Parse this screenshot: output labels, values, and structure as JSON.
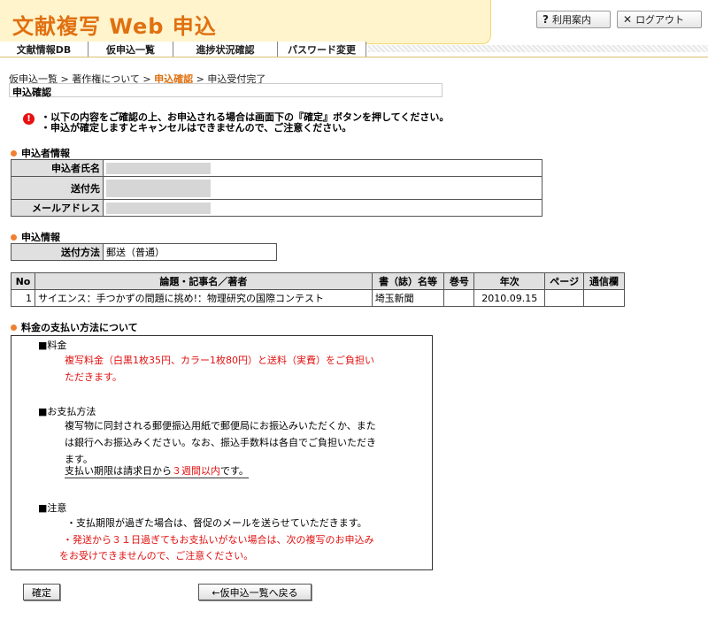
{
  "header": {
    "logo": "文献複写 Web 申込",
    "help_label": "利用案内",
    "help_icon": "?",
    "logout_label": "ログアウト",
    "logout_icon": "✕"
  },
  "nav": {
    "tabs": [
      {
        "label": "文献情報DB"
      },
      {
        "label": "仮申込一覧"
      },
      {
        "label": "進捗状況確認"
      },
      {
        "label": "パスワード変更"
      }
    ]
  },
  "breadcrumb": {
    "items": [
      "仮申込一覧",
      "著作権について",
      "申込確認",
      "申込受付完了"
    ],
    "separator": " > "
  },
  "page_title": "申込確認",
  "notice": {
    "icon": "!",
    "lines": [
      "・以下の内容をご確認の上、お申込される場合は画面下の『確定』ボタンを押してください。",
      "・申込が確定しますとキャンセルはできませんので、ご注意ください。"
    ]
  },
  "applicant": {
    "heading": "申込者情報",
    "name_label": "申込者氏名",
    "address_label": "送付先",
    "email_label": "メールアドレス"
  },
  "application": {
    "heading": "申込情報",
    "method_label": "送付方法",
    "method_value": "郵送（普通）"
  },
  "items_table": {
    "headers": [
      "No",
      "論題・記事名／著者",
      "書（誌）名等",
      "巻号",
      "年次",
      "ページ",
      "通信欄"
    ],
    "rows": [
      {
        "no": "1",
        "title": "サイエンス：手つかずの問題に挑め!：物理研究の国際コンテスト",
        "journal": "埼玉新聞",
        "volume": "",
        "year": "2010.09.15",
        "page": "",
        "note": ""
      }
    ]
  },
  "payment": {
    "heading": "料金の支払い方法について",
    "fee_title": "■料金",
    "fee_lines": [
      "複写料金（白黒1枚35円、カラー1枚80円）と送料（実費）をご負担い",
      "ただきます。"
    ],
    "method_title": "■お支払方法",
    "method_lines": [
      "複写物に同封される郵便振込用紙で郵便局にお振込みいただくか、また",
      "は銀行へお振込みください。なお、振込手数料は各自でご負担いただき",
      "ます。"
    ],
    "deadline_pre": "支払い期限は請求日から",
    "deadline_em": "３週間以内",
    "deadline_post": "です。",
    "caution_title": "■注意",
    "caution_line1": "・支払期限が過ぎた場合は、督促のメールを送らせていただきます。",
    "caution_line2": [
      "・発送から３１日過ぎてもお支払いがない場合は、次の複写のお申込み",
      "をお受けできませんので、ご注意ください。"
    ]
  },
  "buttons": {
    "confirm": "確定",
    "back": "←仮申込一覧へ戻る"
  }
}
